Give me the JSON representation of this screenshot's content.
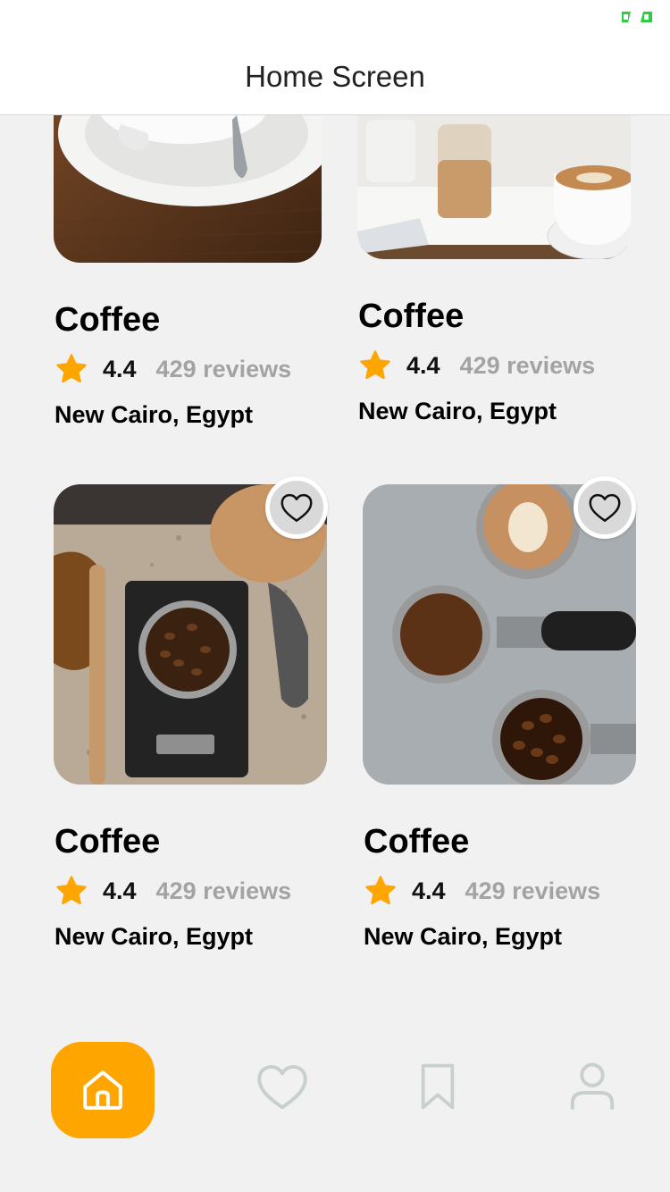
{
  "header": {
    "title": "Home Screen"
  },
  "status": {
    "battery_color": "#2ecc40"
  },
  "cards": [
    {
      "title": "Coffee",
      "rating": "4.4",
      "reviews": "429 reviews",
      "location": "New Cairo, Egypt",
      "image": "coffee-cup-on-saucer"
    },
    {
      "title": "Coffee",
      "rating": "4.4",
      "reviews": "429 reviews",
      "location": "New Cairo, Egypt",
      "image": "latte-on-table"
    },
    {
      "title": "Coffee",
      "rating": "4.4",
      "reviews": "429 reviews",
      "location": "New Cairo, Egypt",
      "image": "coffee-beans-on-scale"
    },
    {
      "title": "Coffee",
      "rating": "4.4",
      "reviews": "429 reviews",
      "location": "New Cairo, Egypt",
      "image": "latte-and-portafilters"
    }
  ],
  "tab_bar": {
    "items": [
      "home-icon",
      "heart-icon",
      "bookmark-icon",
      "user-icon"
    ],
    "active": "home",
    "active_color": "#ffa500",
    "inactive_color": "#c8cfcf"
  },
  "colors": {
    "accent": "#ffa500",
    "star": "#ffa500",
    "muted_text": "#a3a3a3",
    "background": "#f1f1f1"
  }
}
